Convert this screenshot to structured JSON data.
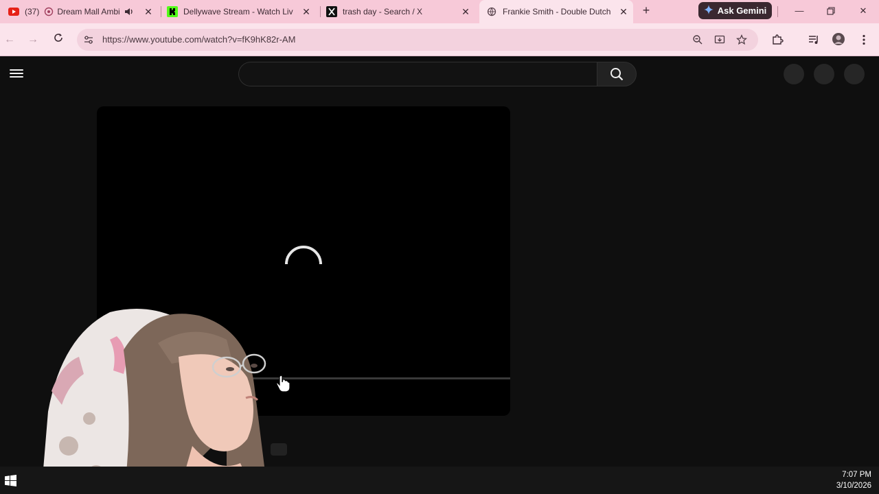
{
  "browser": {
    "tabs": [
      {
        "title": "(37)",
        "title2": "Dream Mall Ambi",
        "favicon": "youtube-icon",
        "audio": "speaker-icon"
      },
      {
        "title": "Dellywave Stream - Watch Live",
        "favicon": "kick-icon"
      },
      {
        "title": "trash day - Search / X",
        "favicon": "x-icon"
      },
      {
        "title": "Frankie Smith - Double Dutch",
        "favicon": "globe-icon",
        "active": true
      }
    ],
    "gemini_label": "Ask Gemini",
    "url": "https://www.youtube.com/watch?v=fK9hK82r-AM"
  },
  "colors": {
    "tabstrip": "#f7c9d8",
    "toolbar": "#fbe4ec",
    "page_bg": "#0f0f0f",
    "player_bg": "#000000"
  },
  "taskbar": {
    "time": "7:07 PM",
    "date": "3/10/2026"
  }
}
